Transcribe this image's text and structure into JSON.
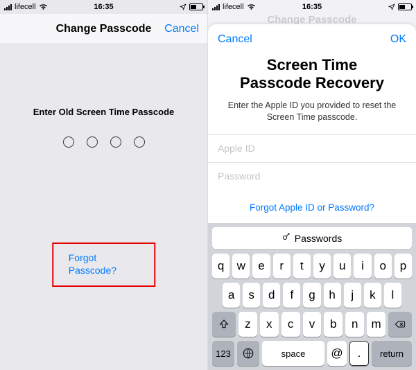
{
  "left": {
    "status": {
      "carrier": "lifecell",
      "time": "16:35"
    },
    "nav": {
      "title": "Change Passcode",
      "cancel": "Cancel"
    },
    "prompt": "Enter Old Screen Time Passcode",
    "forgot": "Forgot Passcode?"
  },
  "right": {
    "status": {
      "carrier": "lifecell",
      "time": "16:35"
    },
    "peek_title": "Change Passcode",
    "sheet": {
      "cancel": "Cancel",
      "ok": "OK",
      "title_line1": "Screen Time",
      "title_line2": "Passcode Recovery",
      "subtitle": "Enter the Apple ID you provided to reset the Screen Time passcode.",
      "apple_id_placeholder": "Apple ID",
      "password_placeholder": "Password",
      "forgot": "Forgot Apple ID or Password?"
    },
    "keyboard": {
      "autofill": "Passwords",
      "row1": [
        "q",
        "w",
        "e",
        "r",
        "t",
        "y",
        "u",
        "i",
        "o",
        "p"
      ],
      "row2": [
        "a",
        "s",
        "d",
        "f",
        "g",
        "h",
        "j",
        "k",
        "l"
      ],
      "row3": [
        "z",
        "x",
        "c",
        "v",
        "b",
        "n",
        "m"
      ],
      "num": "123",
      "space": "space",
      "at": "@",
      "dot": ".",
      "return": "return"
    }
  }
}
